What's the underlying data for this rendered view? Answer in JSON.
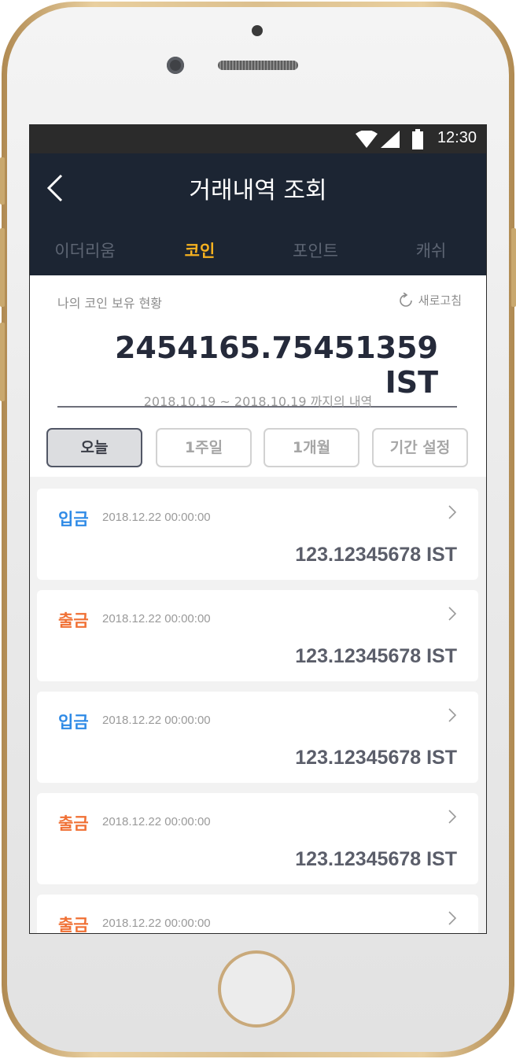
{
  "status": {
    "time": "12:30"
  },
  "header": {
    "title": "거래내역 조회",
    "tabs": [
      {
        "label": "이더리움",
        "active": false
      },
      {
        "label": "코인",
        "active": true
      },
      {
        "label": "포인트",
        "active": false
      },
      {
        "label": "캐쉬",
        "active": false
      }
    ]
  },
  "summary": {
    "holding_label": "나의 코인 보유 현황",
    "refresh_label": "새로고침",
    "balance": "2454165.75451359 IST",
    "range_text": "2018.10.19  ~  2018.10.19 까지의 내역"
  },
  "filters": [
    {
      "label": "오늘",
      "active": true
    },
    {
      "label": "1주일",
      "active": false
    },
    {
      "label": "1개월",
      "active": false
    },
    {
      "label": "기간 설정",
      "active": false
    }
  ],
  "transactions": [
    {
      "type": "입금",
      "kind": "deposit",
      "date": "2018.12.22 00:00:00",
      "amount": "123.12345678 IST"
    },
    {
      "type": "출금",
      "kind": "withdraw",
      "date": "2018.12.22 00:00:00",
      "amount": "123.12345678 IST"
    },
    {
      "type": "입금",
      "kind": "deposit",
      "date": "2018.12.22 00:00:00",
      "amount": "123.12345678 IST"
    },
    {
      "type": "출금",
      "kind": "withdraw",
      "date": "2018.12.22 00:00:00",
      "amount": "123.12345678 IST"
    },
    {
      "type": "출금",
      "kind": "withdraw",
      "date": "2018.12.22 00:00:00",
      "amount": ""
    }
  ],
  "icons": {
    "back": "chevron-left-icon",
    "refresh": "refresh-icon",
    "item_arrow": "chevron-right-icon",
    "wifi": "wifi-icon",
    "signal": "signal-icon",
    "battery": "battery-icon"
  },
  "colors": {
    "header_bg": "#1c2533",
    "active_tab": "#f5b120",
    "deposit": "#2e8ae6",
    "withdraw": "#f07034"
  }
}
